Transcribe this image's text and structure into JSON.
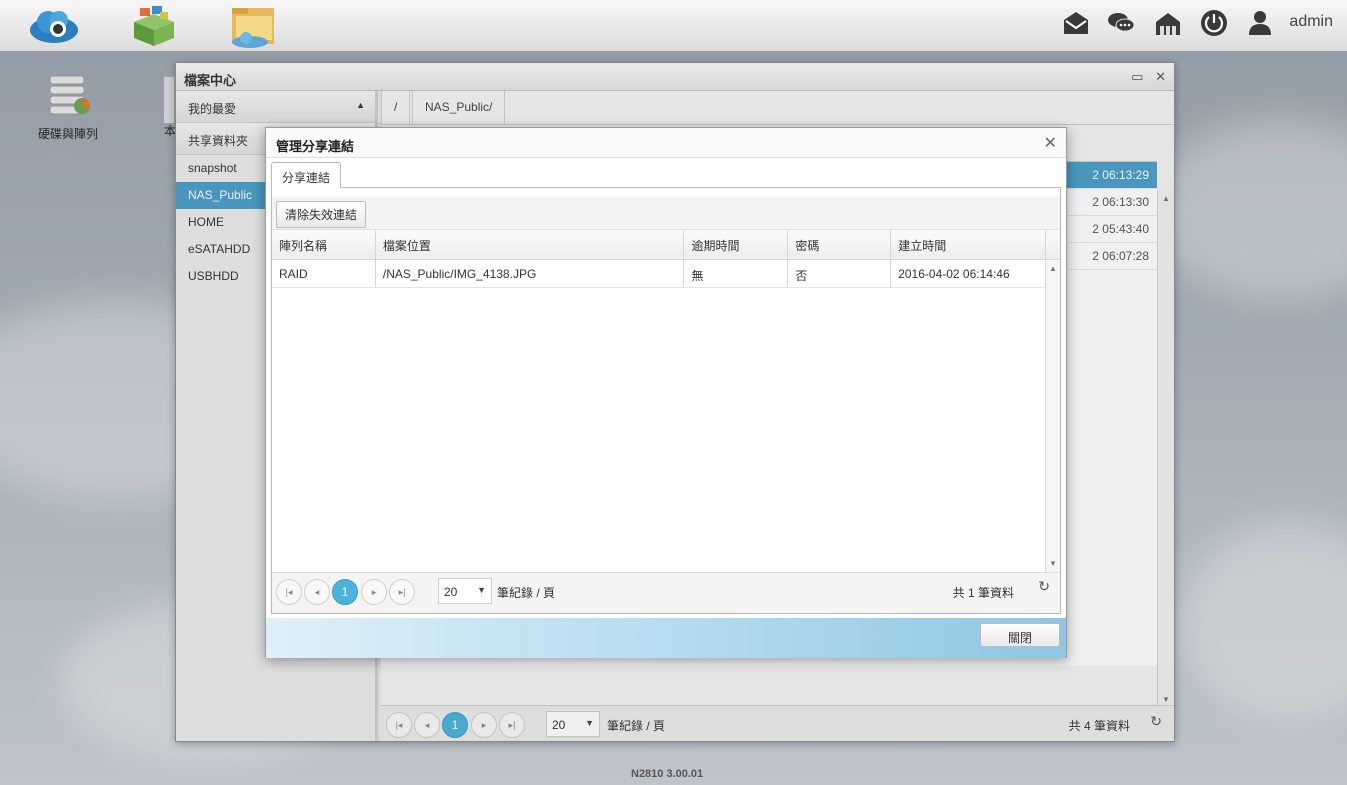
{
  "topbar": {
    "user": "admin",
    "icons": [
      "mail-icon",
      "chat-icon",
      "network-icon",
      "power-icon",
      "user-icon"
    ]
  },
  "desktop": {
    "icon_label": "硬碟與陣列",
    "partial_label": "本"
  },
  "file_center": {
    "title": "檔案中心",
    "sidebar": {
      "favorites": "我的最愛",
      "shared": "共享資料夾",
      "items": [
        "snapshot",
        "NAS_Public",
        "HOME",
        "eSATAHDD",
        "USBHDD"
      ],
      "active": "NAS_Public"
    },
    "breadcrumb": [
      "/",
      "NAS_Public/"
    ],
    "bg_times": [
      "2 06:13:29",
      "2 06:13:30",
      "2 05:43:40",
      "2 06:07:28"
    ],
    "pager": {
      "current": "1",
      "per_page": "20",
      "per_page_label": "筆紀錄 / 頁",
      "total": "共 4 筆資料"
    }
  },
  "modal": {
    "title": "管理分享連結",
    "tab": "分享連結",
    "clear_button": "清除失效連結",
    "columns": [
      "陣列名稱",
      "檔案位置",
      "逾期時間",
      "密碼",
      "建立時間"
    ],
    "rows": [
      [
        "RAID",
        "/NAS_Public/IMG_4138.JPG",
        "無",
        "否",
        "2016-04-02 06:14:46"
      ]
    ],
    "pager": {
      "current": "1",
      "per_page": "20",
      "per_page_label": "筆紀錄 / 頁",
      "total": "共 1 筆資料"
    },
    "close_button": "關閉"
  },
  "version": "N2810   3.00.01"
}
